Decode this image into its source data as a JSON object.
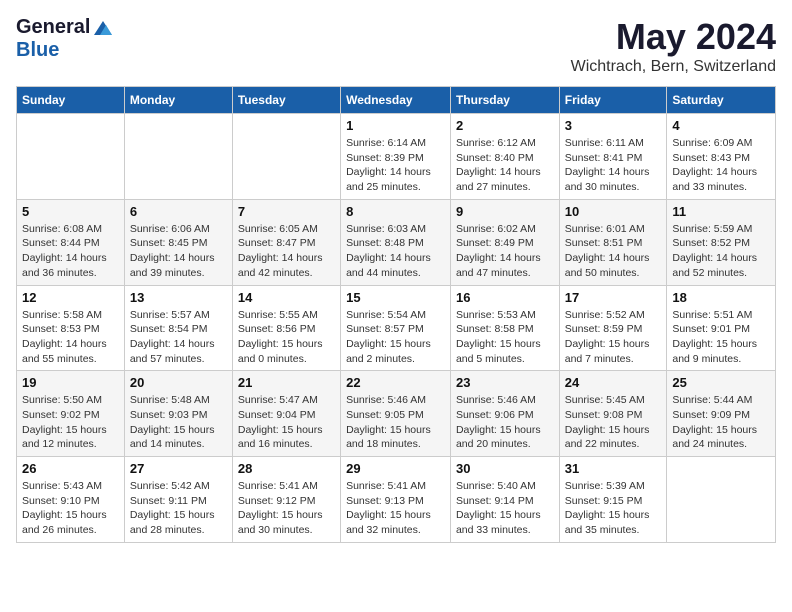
{
  "header": {
    "logo_general": "General",
    "logo_blue": "Blue",
    "month_title": "May 2024",
    "location": "Wichtrach, Bern, Switzerland"
  },
  "weekdays": [
    "Sunday",
    "Monday",
    "Tuesday",
    "Wednesday",
    "Thursday",
    "Friday",
    "Saturday"
  ],
  "weeks": [
    [
      {
        "day": "",
        "info": ""
      },
      {
        "day": "",
        "info": ""
      },
      {
        "day": "",
        "info": ""
      },
      {
        "day": "1",
        "info": "Sunrise: 6:14 AM\nSunset: 8:39 PM\nDaylight: 14 hours\nand 25 minutes."
      },
      {
        "day": "2",
        "info": "Sunrise: 6:12 AM\nSunset: 8:40 PM\nDaylight: 14 hours\nand 27 minutes."
      },
      {
        "day": "3",
        "info": "Sunrise: 6:11 AM\nSunset: 8:41 PM\nDaylight: 14 hours\nand 30 minutes."
      },
      {
        "day": "4",
        "info": "Sunrise: 6:09 AM\nSunset: 8:43 PM\nDaylight: 14 hours\nand 33 minutes."
      }
    ],
    [
      {
        "day": "5",
        "info": "Sunrise: 6:08 AM\nSunset: 8:44 PM\nDaylight: 14 hours\nand 36 minutes."
      },
      {
        "day": "6",
        "info": "Sunrise: 6:06 AM\nSunset: 8:45 PM\nDaylight: 14 hours\nand 39 minutes."
      },
      {
        "day": "7",
        "info": "Sunrise: 6:05 AM\nSunset: 8:47 PM\nDaylight: 14 hours\nand 42 minutes."
      },
      {
        "day": "8",
        "info": "Sunrise: 6:03 AM\nSunset: 8:48 PM\nDaylight: 14 hours\nand 44 minutes."
      },
      {
        "day": "9",
        "info": "Sunrise: 6:02 AM\nSunset: 8:49 PM\nDaylight: 14 hours\nand 47 minutes."
      },
      {
        "day": "10",
        "info": "Sunrise: 6:01 AM\nSunset: 8:51 PM\nDaylight: 14 hours\nand 50 minutes."
      },
      {
        "day": "11",
        "info": "Sunrise: 5:59 AM\nSunset: 8:52 PM\nDaylight: 14 hours\nand 52 minutes."
      }
    ],
    [
      {
        "day": "12",
        "info": "Sunrise: 5:58 AM\nSunset: 8:53 PM\nDaylight: 14 hours\nand 55 minutes."
      },
      {
        "day": "13",
        "info": "Sunrise: 5:57 AM\nSunset: 8:54 PM\nDaylight: 14 hours\nand 57 minutes."
      },
      {
        "day": "14",
        "info": "Sunrise: 5:55 AM\nSunset: 8:56 PM\nDaylight: 15 hours\nand 0 minutes."
      },
      {
        "day": "15",
        "info": "Sunrise: 5:54 AM\nSunset: 8:57 PM\nDaylight: 15 hours\nand 2 minutes."
      },
      {
        "day": "16",
        "info": "Sunrise: 5:53 AM\nSunset: 8:58 PM\nDaylight: 15 hours\nand 5 minutes."
      },
      {
        "day": "17",
        "info": "Sunrise: 5:52 AM\nSunset: 8:59 PM\nDaylight: 15 hours\nand 7 minutes."
      },
      {
        "day": "18",
        "info": "Sunrise: 5:51 AM\nSunset: 9:01 PM\nDaylight: 15 hours\nand 9 minutes."
      }
    ],
    [
      {
        "day": "19",
        "info": "Sunrise: 5:50 AM\nSunset: 9:02 PM\nDaylight: 15 hours\nand 12 minutes."
      },
      {
        "day": "20",
        "info": "Sunrise: 5:48 AM\nSunset: 9:03 PM\nDaylight: 15 hours\nand 14 minutes."
      },
      {
        "day": "21",
        "info": "Sunrise: 5:47 AM\nSunset: 9:04 PM\nDaylight: 15 hours\nand 16 minutes."
      },
      {
        "day": "22",
        "info": "Sunrise: 5:46 AM\nSunset: 9:05 PM\nDaylight: 15 hours\nand 18 minutes."
      },
      {
        "day": "23",
        "info": "Sunrise: 5:46 AM\nSunset: 9:06 PM\nDaylight: 15 hours\nand 20 minutes."
      },
      {
        "day": "24",
        "info": "Sunrise: 5:45 AM\nSunset: 9:08 PM\nDaylight: 15 hours\nand 22 minutes."
      },
      {
        "day": "25",
        "info": "Sunrise: 5:44 AM\nSunset: 9:09 PM\nDaylight: 15 hours\nand 24 minutes."
      }
    ],
    [
      {
        "day": "26",
        "info": "Sunrise: 5:43 AM\nSunset: 9:10 PM\nDaylight: 15 hours\nand 26 minutes."
      },
      {
        "day": "27",
        "info": "Sunrise: 5:42 AM\nSunset: 9:11 PM\nDaylight: 15 hours\nand 28 minutes."
      },
      {
        "day": "28",
        "info": "Sunrise: 5:41 AM\nSunset: 9:12 PM\nDaylight: 15 hours\nand 30 minutes."
      },
      {
        "day": "29",
        "info": "Sunrise: 5:41 AM\nSunset: 9:13 PM\nDaylight: 15 hours\nand 32 minutes."
      },
      {
        "day": "30",
        "info": "Sunrise: 5:40 AM\nSunset: 9:14 PM\nDaylight: 15 hours\nand 33 minutes."
      },
      {
        "day": "31",
        "info": "Sunrise: 5:39 AM\nSunset: 9:15 PM\nDaylight: 15 hours\nand 35 minutes."
      },
      {
        "day": "",
        "info": ""
      }
    ]
  ]
}
